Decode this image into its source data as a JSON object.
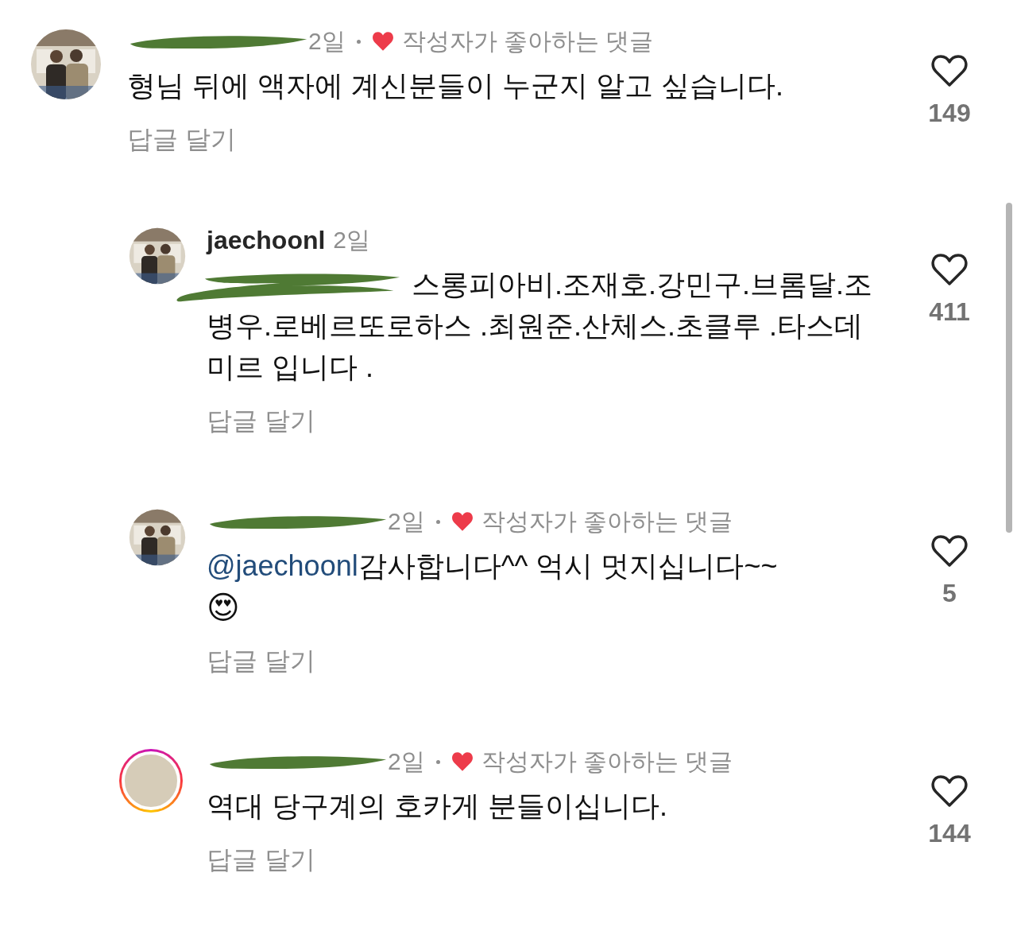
{
  "comments": [
    {
      "story_ring": false,
      "author_redacted": true,
      "time": "2일",
      "creator_liked": true,
      "creator_liked_label": "작성자가 좋아하는 댓글",
      "text": "형님 뒤에 액자에 계신분들이 누군지 알고 싶습니다.",
      "reply_label": "답글 달기",
      "liked": false,
      "likes": "149",
      "children": [
        {
          "story_ring": false,
          "author": "jaechoonl",
          "time": "2일",
          "creator_liked": false,
          "mention_redacted": true,
          "text": "스롱피아비.조재호.강민구.브롬달.조병우.로베르또로하스 .최원준.산체스.초클루 .타스데미르  입니다 .",
          "reply_label": "답글 달기",
          "liked": false,
          "likes": "411"
        },
        {
          "story_ring": false,
          "author_redacted": true,
          "time": "2일",
          "creator_liked": true,
          "creator_liked_label": "작성자가 좋아하는 댓글",
          "mention": "@jaechoonl",
          "text": "감사합니다^^ 억시 멋지십니다~~",
          "emoji": "😍",
          "reply_label": "답글 달기",
          "liked": false,
          "likes": "5"
        },
        {
          "story_ring": true,
          "author_redacted": true,
          "time": "2일",
          "creator_liked": true,
          "creator_liked_label": "작성자가 좋아하는 댓글",
          "text": "역대 당구계의 호카게 분들이십니다.",
          "reply_label": "답글 달기",
          "liked": false,
          "likes": "144"
        }
      ]
    }
  ]
}
